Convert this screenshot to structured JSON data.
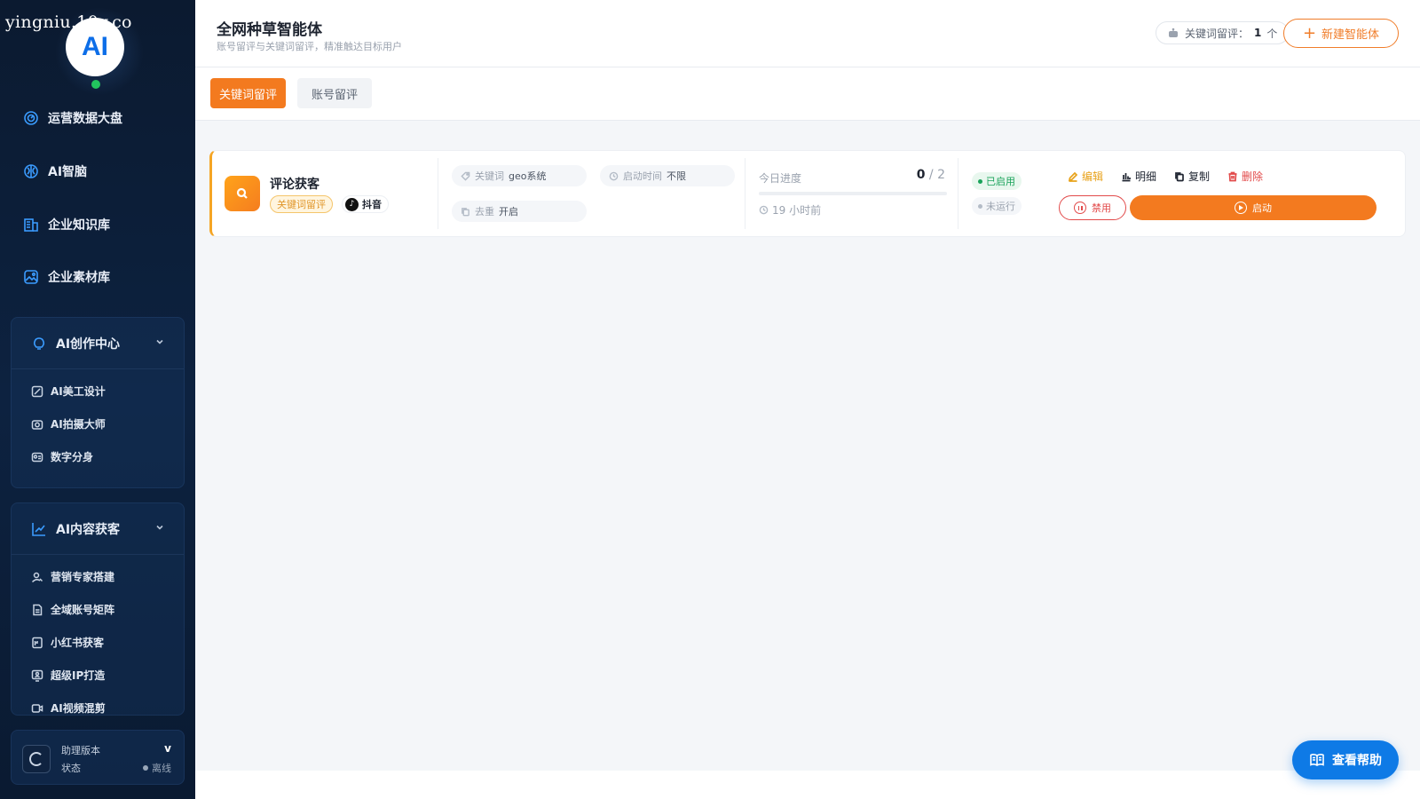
{
  "watermark": "yingniu.10v.co",
  "logo": {
    "text": "AI"
  },
  "sidebar": {
    "nav": [
      {
        "label": "运营数据大盘",
        "icon": "dashboard-icon"
      },
      {
        "label": "AI智脑",
        "icon": "brain-icon"
      },
      {
        "label": "企业知识库",
        "icon": "knowledge-icon"
      },
      {
        "label": "企业素材库",
        "icon": "image-icon"
      }
    ],
    "groups": [
      {
        "title": "AI创作中心",
        "items": [
          {
            "label": "AI美工设计"
          },
          {
            "label": "AI拍摄大师"
          },
          {
            "label": "数字分身"
          }
        ]
      },
      {
        "title": "AI内容获客",
        "items": [
          {
            "label": "营销专家搭建"
          },
          {
            "label": "全域账号矩阵"
          },
          {
            "label": "小红书获客"
          },
          {
            "label": "超级IP打造"
          },
          {
            "label": "AI视频混剪"
          }
        ]
      }
    ],
    "footer": {
      "line1": "助理版本",
      "line2": "状态",
      "version": "v",
      "status": "离线"
    }
  },
  "header": {
    "title": "全网种草智能体",
    "subtitle": "账号留评与关键词留评，精准触达目标用户",
    "counter_label": "关键词留评：",
    "counter_value": "1",
    "counter_unit": "个",
    "new_button": "新建智能体"
  },
  "tabs": [
    {
      "label": "关键词留评",
      "active": true
    },
    {
      "label": "账号留评",
      "active": false
    }
  ],
  "card": {
    "name": "评论获客",
    "badge": "关键词留评",
    "platform": "抖音",
    "keyword_label": "关键词",
    "keyword_value": "geo系统",
    "start_label": "启动时间",
    "start_value": "不限",
    "dedupe_label": "去重",
    "dedupe_value": "开启",
    "progress_label": "今日进度",
    "progress_done": "0",
    "progress_total": "/ 2",
    "progress_fraction": 0,
    "last_time": "19 小时前",
    "status_enabled": "已启用",
    "status_running": "未运行",
    "actions": {
      "edit": "编辑",
      "detail": "明细",
      "copy": "复制",
      "delete": "删除",
      "disable": "禁用",
      "start": "启动"
    }
  },
  "help_button": "查看帮助",
  "colors": {
    "accent": "#f37a1f",
    "sidebar_bg": "#0b1a30",
    "primary_blue": "#0e7ae6",
    "success": "#1aa35a",
    "danger": "#e24a4a"
  }
}
